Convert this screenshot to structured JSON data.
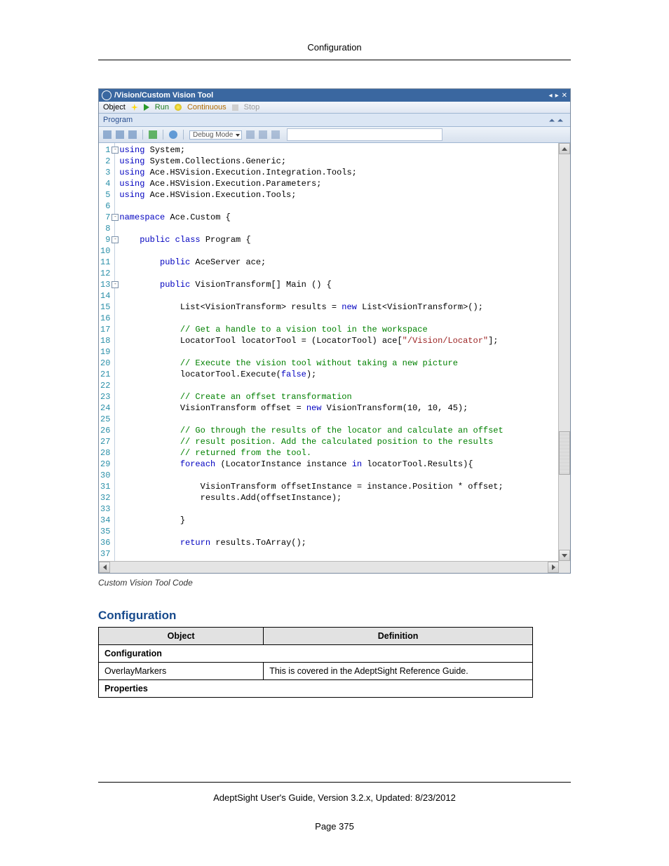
{
  "header": {
    "title": "Configuration"
  },
  "ide": {
    "window_title": "/Vision/Custom Vision Tool",
    "menubar": {
      "object": "Object",
      "run": "Run",
      "continuous": "Continuous",
      "stop": "Stop"
    },
    "section_label": "Program",
    "toolbar": {
      "mode": "Debug Mode"
    },
    "code": {
      "lines": [
        {
          "n": 1,
          "fold": "-",
          "segs": [
            {
              "c": "kw",
              "t": "using"
            },
            {
              "c": "",
              "t": " System;"
            }
          ]
        },
        {
          "n": 2,
          "segs": [
            {
              "c": "kw",
              "t": "using"
            },
            {
              "c": "",
              "t": " System.Collections.Generic;"
            }
          ]
        },
        {
          "n": 3,
          "segs": [
            {
              "c": "kw",
              "t": "using"
            },
            {
              "c": "",
              "t": " Ace.HSVision.Execution.Integration.Tools;"
            }
          ]
        },
        {
          "n": 4,
          "segs": [
            {
              "c": "kw",
              "t": "using"
            },
            {
              "c": "",
              "t": " Ace.HSVision.Execution.Parameters;"
            }
          ]
        },
        {
          "n": 5,
          "segs": [
            {
              "c": "kw",
              "t": "using"
            },
            {
              "c": "",
              "t": " Ace.HSVision.Execution.Tools;"
            }
          ]
        },
        {
          "n": 6,
          "segs": []
        },
        {
          "n": 7,
          "fold": "-",
          "segs": [
            {
              "c": "kw",
              "t": "namespace"
            },
            {
              "c": "",
              "t": " Ace.Custom {"
            }
          ]
        },
        {
          "n": 8,
          "segs": []
        },
        {
          "n": 9,
          "fold": "-",
          "segs": [
            {
              "c": "",
              "t": "    "
            },
            {
              "c": "kw",
              "t": "public class"
            },
            {
              "c": "",
              "t": " Program {"
            }
          ]
        },
        {
          "n": 10,
          "segs": []
        },
        {
          "n": 11,
          "segs": [
            {
              "c": "",
              "t": "        "
            },
            {
              "c": "kw",
              "t": "public"
            },
            {
              "c": "",
              "t": " AceServer ace;"
            }
          ]
        },
        {
          "n": 12,
          "segs": []
        },
        {
          "n": 13,
          "fold": "-",
          "segs": [
            {
              "c": "",
              "t": "        "
            },
            {
              "c": "kw",
              "t": "public"
            },
            {
              "c": "",
              "t": " VisionTransform[] Main () {"
            }
          ]
        },
        {
          "n": 14,
          "segs": []
        },
        {
          "n": 15,
          "segs": [
            {
              "c": "",
              "t": "            List<VisionTransform> results = "
            },
            {
              "c": "kw",
              "t": "new"
            },
            {
              "c": "",
              "t": " List<VisionTransform>();"
            }
          ]
        },
        {
          "n": 16,
          "segs": []
        },
        {
          "n": 17,
          "segs": [
            {
              "c": "",
              "t": "            "
            },
            {
              "c": "cm",
              "t": "// Get a handle to a vision tool in the workspace"
            }
          ]
        },
        {
          "n": 18,
          "segs": [
            {
              "c": "",
              "t": "            LocatorTool locatorTool = (LocatorTool) ace["
            },
            {
              "c": "str",
              "t": "\"/Vision/Locator\""
            },
            {
              "c": "",
              "t": "];"
            }
          ]
        },
        {
          "n": 19,
          "segs": []
        },
        {
          "n": 20,
          "segs": [
            {
              "c": "",
              "t": "            "
            },
            {
              "c": "cm",
              "t": "// Execute the vision tool without taking a new picture"
            }
          ]
        },
        {
          "n": 21,
          "segs": [
            {
              "c": "",
              "t": "            locatorTool.Execute("
            },
            {
              "c": "kw",
              "t": "false"
            },
            {
              "c": "",
              "t": ");"
            }
          ]
        },
        {
          "n": 22,
          "segs": []
        },
        {
          "n": 23,
          "segs": [
            {
              "c": "",
              "t": "            "
            },
            {
              "c": "cm",
              "t": "// Create an offset transformation"
            }
          ]
        },
        {
          "n": 24,
          "segs": [
            {
              "c": "",
              "t": "            VisionTransform offset = "
            },
            {
              "c": "kw",
              "t": "new"
            },
            {
              "c": "",
              "t": " VisionTransform(10, 10, 45);"
            }
          ]
        },
        {
          "n": 25,
          "segs": []
        },
        {
          "n": 26,
          "segs": [
            {
              "c": "",
              "t": "            "
            },
            {
              "c": "cm",
              "t": "// Go through the results of the locator and calculate an offset"
            }
          ]
        },
        {
          "n": 27,
          "segs": [
            {
              "c": "",
              "t": "            "
            },
            {
              "c": "cm",
              "t": "// result position. Add the calculated position to the results"
            }
          ]
        },
        {
          "n": 28,
          "segs": [
            {
              "c": "",
              "t": "            "
            },
            {
              "c": "cm",
              "t": "// returned from the tool."
            }
          ]
        },
        {
          "n": 29,
          "segs": [
            {
              "c": "",
              "t": "            "
            },
            {
              "c": "kw",
              "t": "foreach"
            },
            {
              "c": "",
              "t": " (LocatorInstance instance "
            },
            {
              "c": "kw",
              "t": "in"
            },
            {
              "c": "",
              "t": " locatorTool.Results){"
            }
          ]
        },
        {
          "n": 30,
          "segs": []
        },
        {
          "n": 31,
          "segs": [
            {
              "c": "",
              "t": "                VisionTransform offsetInstance = instance.Position * offset;"
            }
          ]
        },
        {
          "n": 32,
          "segs": [
            {
              "c": "",
              "t": "                results.Add(offsetInstance);"
            }
          ]
        },
        {
          "n": 33,
          "segs": []
        },
        {
          "n": 34,
          "segs": [
            {
              "c": "",
              "t": "            }"
            }
          ]
        },
        {
          "n": 35,
          "segs": []
        },
        {
          "n": 36,
          "segs": [
            {
              "c": "",
              "t": "            "
            },
            {
              "c": "kw",
              "t": "return"
            },
            {
              "c": "",
              "t": " results.ToArray();"
            }
          ]
        },
        {
          "n": 37,
          "segs": []
        }
      ]
    }
  },
  "caption": "Custom Vision Tool Code",
  "config_section": {
    "heading": "Configuration",
    "col_object": "Object",
    "col_definition": "Definition",
    "group1": "Configuration",
    "row1_obj": "OverlayMarkers",
    "row1_def": "This is covered in the AdeptSight Reference Guide.",
    "group2": "Properties"
  },
  "footer": {
    "text": "AdeptSight User's Guide,  Version 3.2.x, Updated: 8/23/2012",
    "page": "Page 375"
  }
}
